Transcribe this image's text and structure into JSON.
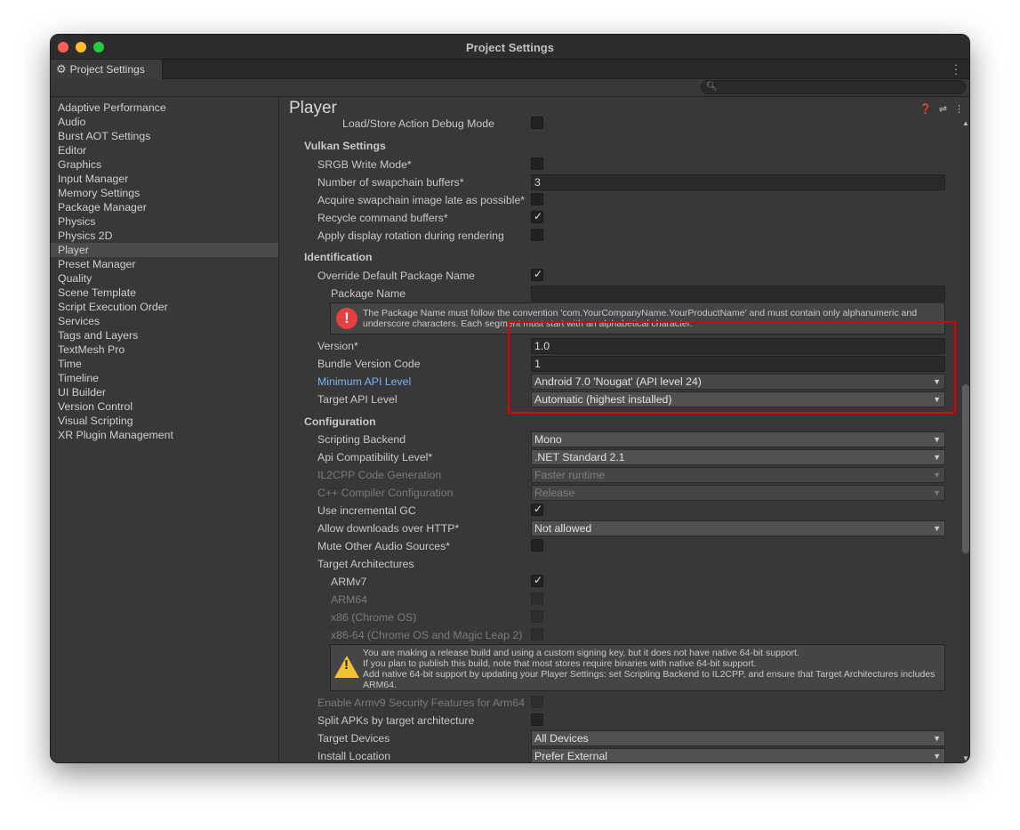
{
  "window": {
    "title": "Project Settings"
  },
  "tab": {
    "label": "Project Settings",
    "icon": "gear-icon"
  },
  "search": {
    "value": ""
  },
  "sidebar": {
    "items": [
      "Adaptive Performance",
      "Audio",
      "Burst AOT Settings",
      "Editor",
      "Graphics",
      "Input Manager",
      "Memory Settings",
      "Package Manager",
      "Physics",
      "Physics 2D",
      "Player",
      "Preset Manager",
      "Quality",
      "Scene Template",
      "Script Execution Order",
      "Services",
      "Tags and Layers",
      "TextMesh Pro",
      "Time",
      "Timeline",
      "UI Builder",
      "Version Control",
      "Visual Scripting",
      "XR Plugin Management"
    ],
    "selected": "Player"
  },
  "main": {
    "title": "Player",
    "load_store": {
      "label": "Load/Store Action Debug Mode",
      "checked": false
    },
    "vulkan": {
      "header": "Vulkan Settings",
      "srgb": {
        "label": "SRGB Write Mode*",
        "checked": false
      },
      "swapchain": {
        "label": "Number of swapchain buffers*",
        "value": "3"
      },
      "acquire": {
        "label": "Acquire swapchain image late as possible*",
        "checked": false
      },
      "recycle": {
        "label": "Recycle command buffers*",
        "checked": true
      },
      "rotation": {
        "label": "Apply display rotation during rendering",
        "checked": false
      }
    },
    "identification": {
      "header": "Identification",
      "override": {
        "label": "Override Default Package Name",
        "checked": true
      },
      "package_name": {
        "label": "Package Name",
        "value": ""
      },
      "error_help": "The Package Name must follow the convention 'com.YourCompanyName.YourProductName' and must contain only alphanumeric and underscore characters. Each segment must start with an alphabetical character.",
      "version": {
        "label": "Version*",
        "value": "1.0"
      },
      "bundle_code": {
        "label": "Bundle Version Code",
        "value": "1"
      },
      "min_api": {
        "label": "Minimum API Level",
        "value": "Android 7.0 'Nougat' (API level 24)"
      },
      "target_api": {
        "label": "Target API Level",
        "value": "Automatic (highest installed)"
      }
    },
    "configuration": {
      "header": "Configuration",
      "scripting_backend": {
        "label": "Scripting Backend",
        "value": "Mono"
      },
      "api_compat": {
        "label": "Api Compatibility Level*",
        "value": ".NET Standard 2.1"
      },
      "il2cpp": {
        "label": "IL2CPP Code Generation",
        "value": "Faster runtime"
      },
      "cpp_compiler": {
        "label": "C++ Compiler Configuration",
        "value": "Release"
      },
      "incremental_gc": {
        "label": "Use incremental GC",
        "checked": true
      },
      "http": {
        "label": "Allow downloads over HTTP*",
        "value": "Not allowed"
      },
      "mute_audio": {
        "label": "Mute Other Audio Sources*",
        "checked": false
      },
      "target_arch": {
        "label": "Target Architectures",
        "armv7": {
          "label": "ARMv7",
          "checked": true
        },
        "arm64": {
          "label": "ARM64",
          "checked": false
        },
        "x86": {
          "label": "x86 (Chrome OS)",
          "checked": false
        },
        "x86_64": {
          "label": "x86-64 (Chrome OS and Magic Leap 2)",
          "checked": false
        }
      },
      "warn_help": {
        "line1": "You are making a release build and using a custom signing key, but it does not have native 64-bit support.",
        "line2": "If you plan to publish this build, note that most stores require binaries with native 64-bit support.",
        "line3": "Add native 64-bit support by updating your Player Settings: set Scripting Backend to IL2CPP, and ensure that Target Architectures includes ARM64."
      },
      "armv9": {
        "label": "Enable Armv9 Security Features for Arm64",
        "checked": false
      },
      "split_apks": {
        "label": "Split APKs by target architecture",
        "checked": false
      },
      "target_devices": {
        "label": "Target Devices",
        "value": "All Devices"
      },
      "install_location": {
        "label": "Install Location",
        "value": "Prefer External"
      }
    }
  },
  "colors": {
    "highlight_box": "#e00000",
    "link_label": "#7cb2f0"
  }
}
